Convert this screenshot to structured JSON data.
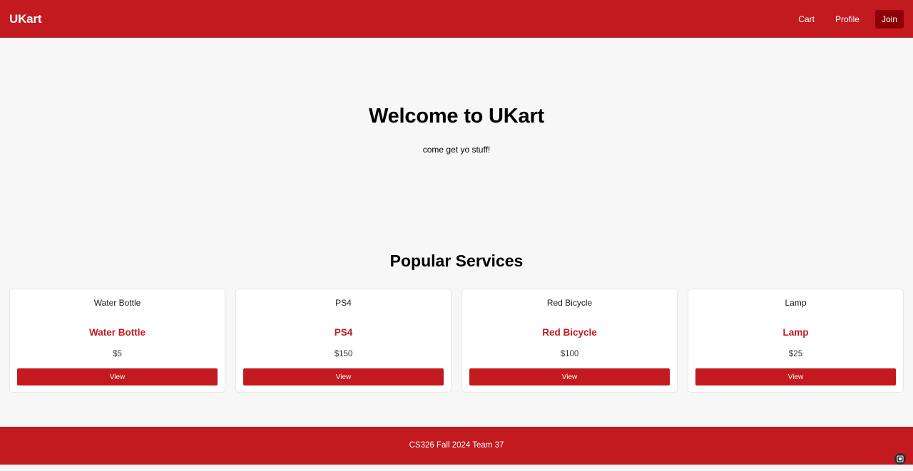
{
  "nav": {
    "brand": "UKart",
    "links": [
      {
        "label": "Cart"
      },
      {
        "label": "Profile"
      },
      {
        "label": "Join"
      }
    ]
  },
  "hero": {
    "title": "Welcome to UKart",
    "subtitle": "come get yo stuff!"
  },
  "popular": {
    "title": "Popular Services",
    "items": [
      {
        "image_alt": "Water Bottle",
        "name": "Water Bottle",
        "price": "$5",
        "button": "View"
      },
      {
        "image_alt": "PS4",
        "name": "PS4",
        "price": "$150",
        "button": "View"
      },
      {
        "image_alt": "Red Bicycle",
        "name": "Red Bicycle",
        "price": "$100",
        "button": "View"
      },
      {
        "image_alt": "Lamp",
        "name": "Lamp",
        "price": "$25",
        "button": "View"
      }
    ]
  },
  "footer": {
    "text": "CS326 Fall 2024 Team 37"
  },
  "colors": {
    "brand_red": "#c21a1f",
    "join_dark": "#8e0006",
    "background": "#f7f7f7"
  }
}
